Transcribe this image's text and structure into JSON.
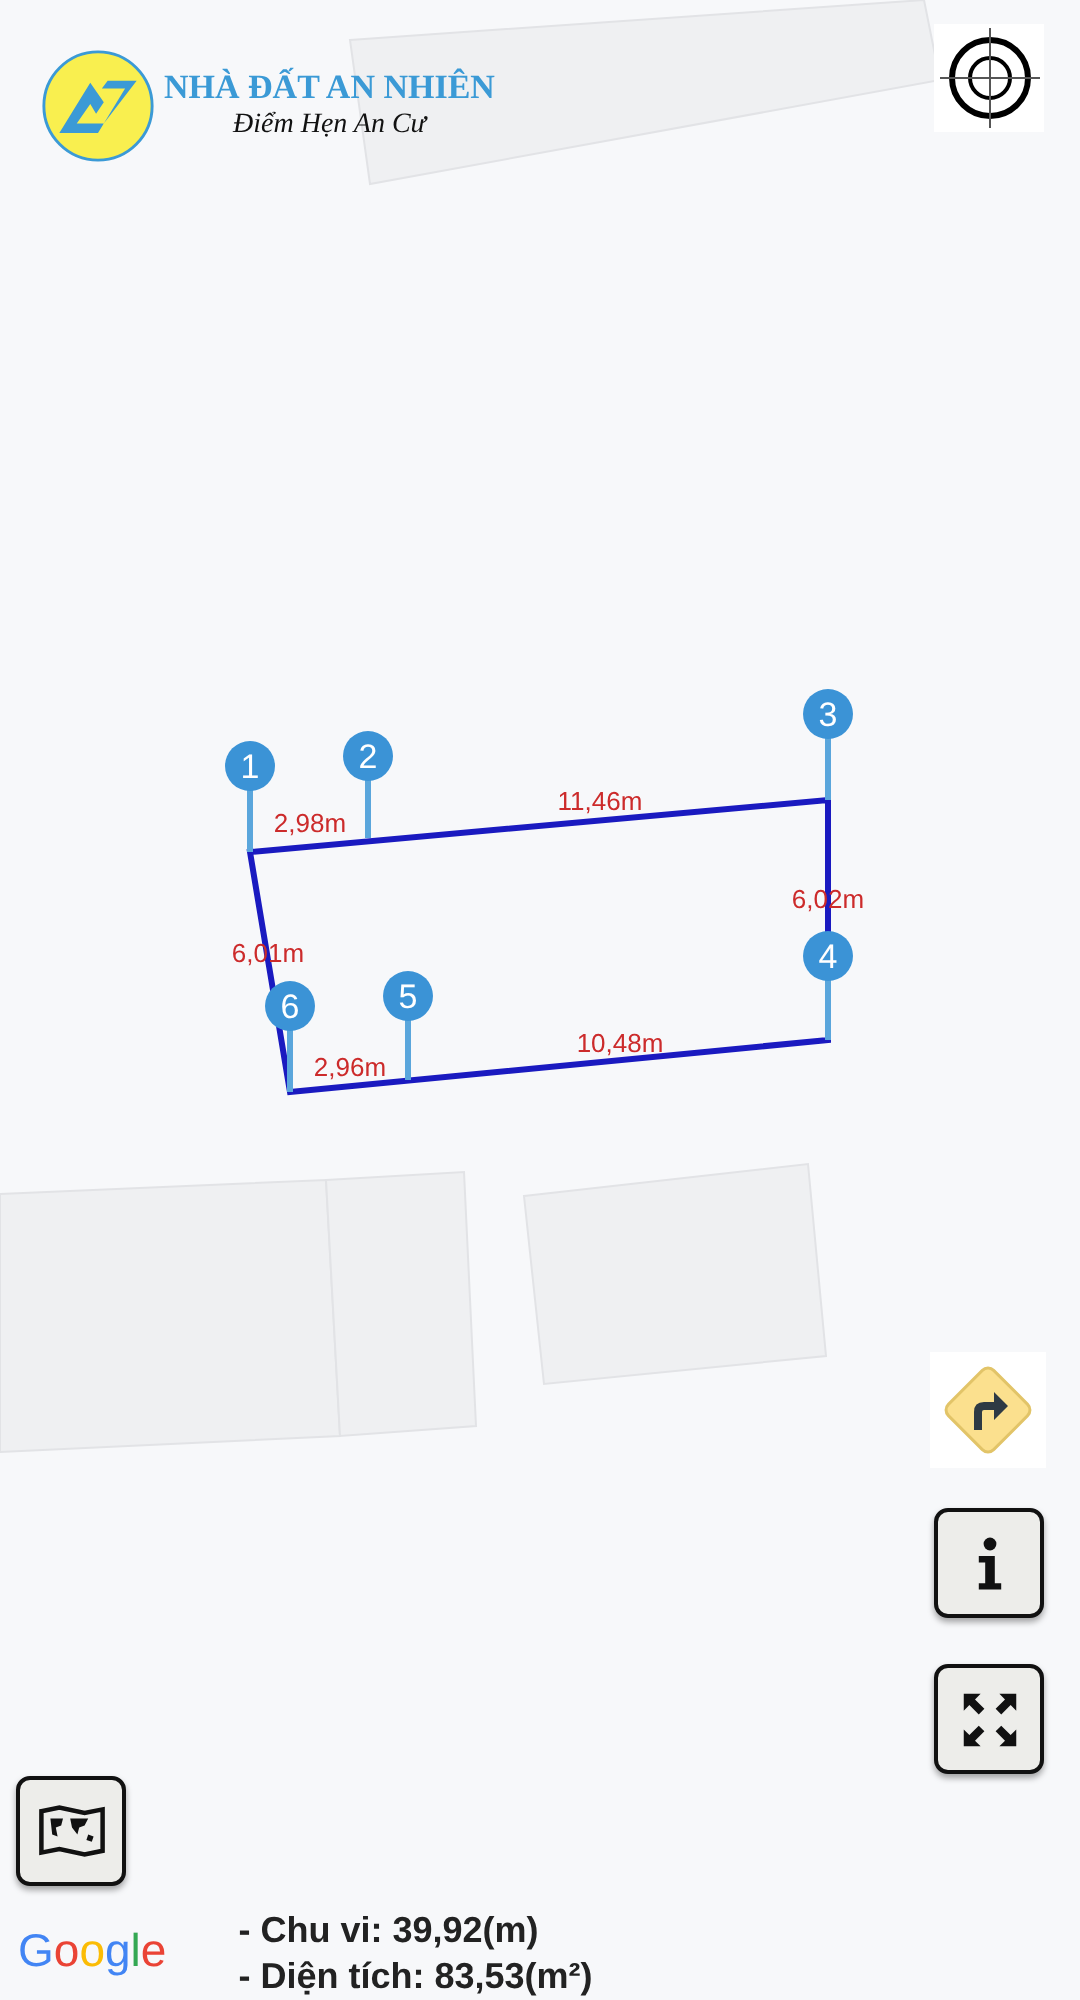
{
  "logo": {
    "title": "NHÀ ĐẤT AN NHIÊN",
    "tagline": "Điểm Hẹn An Cư"
  },
  "map": {
    "pins": [
      {
        "label": "1"
      },
      {
        "label": "2"
      },
      {
        "label": "3"
      },
      {
        "label": "4"
      },
      {
        "label": "5"
      },
      {
        "label": "6"
      }
    ],
    "edge_labels": [
      "2,98m",
      "11,46m",
      "6,02m",
      "10,48m",
      "2,96m",
      "6,01m"
    ]
  },
  "attribution": "Google",
  "summary": [
    "- Chu vi: 39,92(m)",
    "- Diện tích: 83,53(m²)"
  ]
}
